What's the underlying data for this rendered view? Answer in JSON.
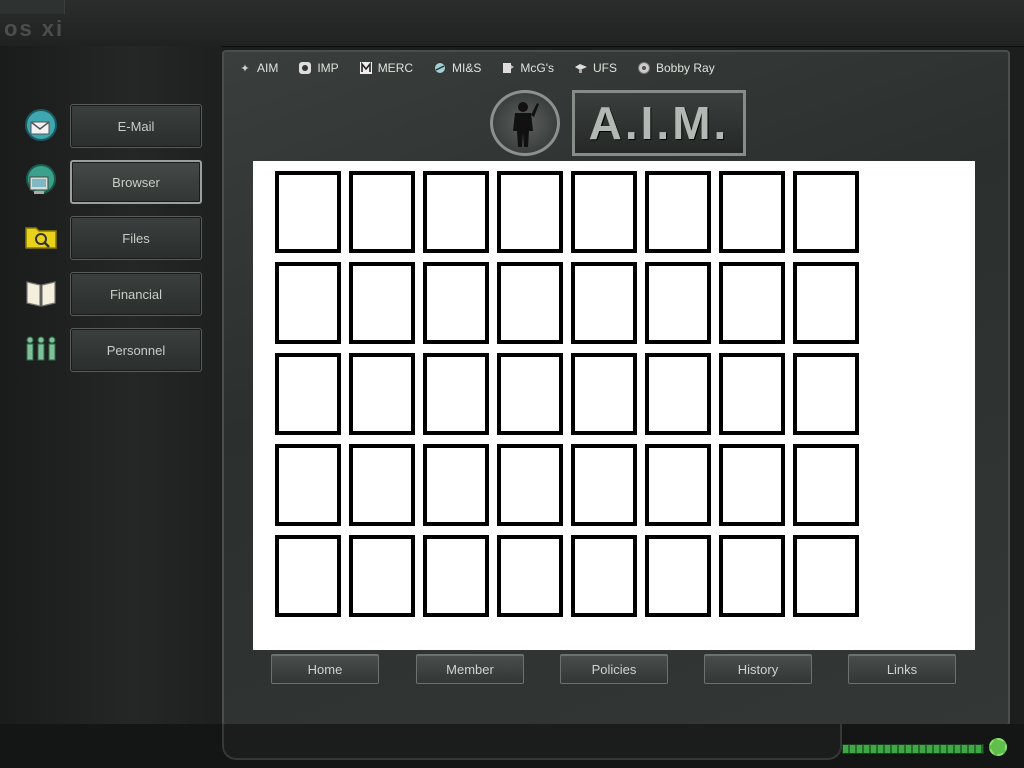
{
  "os_title": "os xi",
  "sidebar": {
    "items": [
      {
        "label": "E-Mail",
        "icon": "email-icon",
        "active": false
      },
      {
        "label": "Browser",
        "icon": "browser-icon",
        "active": true
      },
      {
        "label": "Files",
        "icon": "files-icon",
        "active": false
      },
      {
        "label": "Financial",
        "icon": "financial-icon",
        "active": false
      },
      {
        "label": "Personnel",
        "icon": "personnel-icon",
        "active": false
      }
    ]
  },
  "bookmarks": [
    {
      "label": "AIM",
      "icon": "aim-bookmark-icon"
    },
    {
      "label": "IMP",
      "icon": "imp-bookmark-icon"
    },
    {
      "label": "MERC",
      "icon": "merc-bookmark-icon"
    },
    {
      "label": "MI&S",
      "icon": "mis-bookmark-icon"
    },
    {
      "label": "McG's",
      "icon": "mcgs-bookmark-icon"
    },
    {
      "label": "UFS",
      "icon": "ufs-bookmark-icon"
    },
    {
      "label": "Bobby Ray",
      "icon": "bobby-ray-bookmark-icon"
    }
  ],
  "logo": {
    "text": "A.I.M.",
    "emblem": "soldier-silhouette-icon"
  },
  "member_grid": {
    "rows": 5,
    "columns": 8
  },
  "nav": {
    "buttons": [
      "Home",
      "Member",
      "Policies",
      "History",
      "Links"
    ]
  },
  "colors": {
    "accent_green": "#3ea845",
    "frame": "#3a3e3c",
    "content_bg": "#ffffff"
  }
}
